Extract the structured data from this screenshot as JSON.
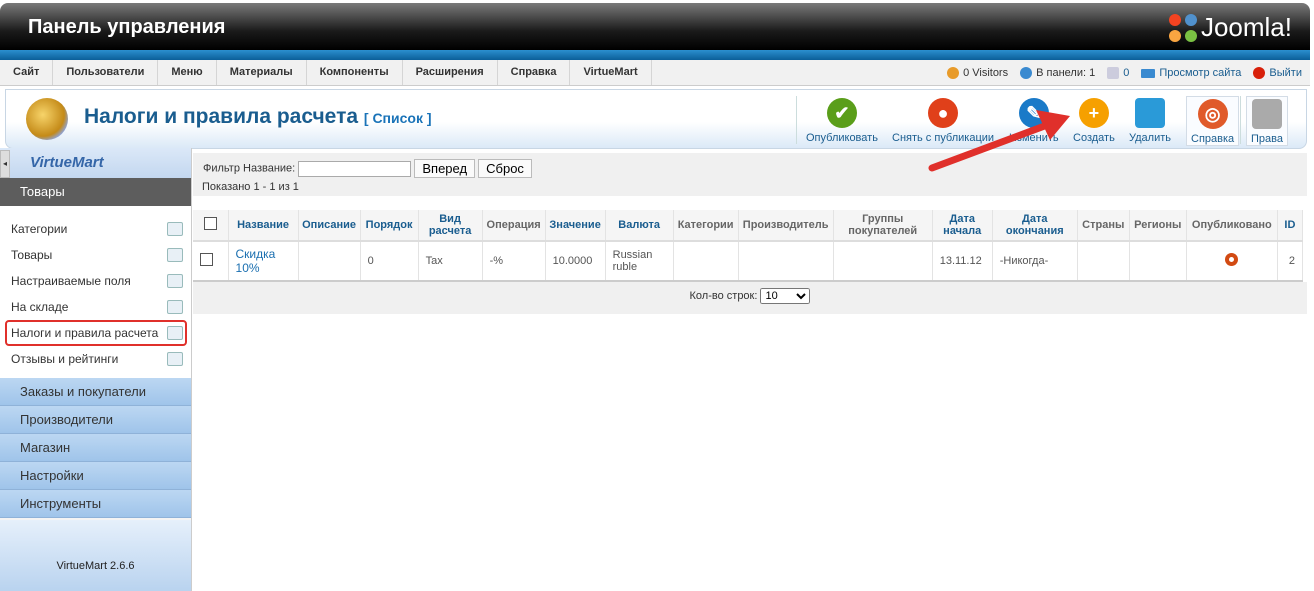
{
  "header": {
    "title": "Панель управления",
    "logo_text": "Joomla!"
  },
  "menu": [
    "Сайт",
    "Пользователи",
    "Меню",
    "Материалы",
    "Компоненты",
    "Расширения",
    "Справка",
    "VirtueMart"
  ],
  "status": {
    "visitors": "0 Visitors",
    "admins": "В панели: 1",
    "messages": "0",
    "view_site": "Просмотр сайта",
    "logout": "Выйти"
  },
  "page": {
    "title": "Налоги и правила расчета",
    "subtitle": "[ Список ]"
  },
  "toolbar": [
    {
      "label": "Опубликовать",
      "icon": "check-icon",
      "color": "#5a9e1a"
    },
    {
      "label": "Снять с публикации",
      "icon": "unpublish-icon",
      "color": "#e0401a"
    },
    {
      "label": "Изменить",
      "icon": "edit-icon",
      "color": "#1a7ac8"
    },
    {
      "label": "Создать",
      "icon": "plus-icon",
      "color": "#f6a000"
    },
    {
      "label": "Удалить",
      "icon": "trash-icon",
      "color": "#2a9ad8"
    },
    {
      "label": "Справка",
      "icon": "lifebuoy-icon",
      "color": "#e05a2a"
    },
    {
      "label": "Права",
      "icon": "lock-icon",
      "color": "#aaaaaa"
    }
  ],
  "sidebar": {
    "logo": "VirtueMart",
    "section": "Товары",
    "items": [
      "Категории",
      "Товары",
      "Настраиваемые поля",
      "На складе",
      "Налоги и правила расчета",
      "Отзывы и рейтинги"
    ],
    "active_index": 4,
    "groups": [
      "Заказы и покупатели",
      "Производители",
      "Магазин",
      "Настройки",
      "Инструменты"
    ],
    "version": "VirtueMart 2.6.6"
  },
  "filter": {
    "label": "Фильтр Название:",
    "value": "",
    "go": "Вперед",
    "reset": "Сброс",
    "shown": "Показано 1 - 1 из 1"
  },
  "table": {
    "columns": [
      {
        "label": "Название",
        "sortable": true
      },
      {
        "label": "Описание",
        "sortable": true
      },
      {
        "label": "Порядок",
        "sortable": true
      },
      {
        "label": "Вид расчета",
        "sortable": true
      },
      {
        "label": "Операция",
        "sortable": false
      },
      {
        "label": "Значение",
        "sortable": true
      },
      {
        "label": "Валюта",
        "sortable": true
      },
      {
        "label": "Категории",
        "sortable": false
      },
      {
        "label": "Производитель",
        "sortable": false
      },
      {
        "label": "Группы покупателей",
        "sortable": false
      },
      {
        "label": "Дата начала",
        "sortable": true
      },
      {
        "label": "Дата окончания",
        "sortable": true
      },
      {
        "label": "Страны",
        "sortable": false
      },
      {
        "label": "Регионы",
        "sortable": false
      },
      {
        "label": "Опубликовано",
        "sortable": false
      },
      {
        "label": "ID",
        "sortable": true
      }
    ],
    "rows": [
      [
        "Скидка 10%",
        "",
        "0",
        "Tax",
        "-%",
        "10.0000",
        "Russian ruble",
        "",
        "",
        "",
        "13.11.12",
        "-Никогда-",
        "",
        "",
        "published",
        "2"
      ]
    ]
  },
  "pager": {
    "label": "Кол-во строк:",
    "value": "10"
  }
}
